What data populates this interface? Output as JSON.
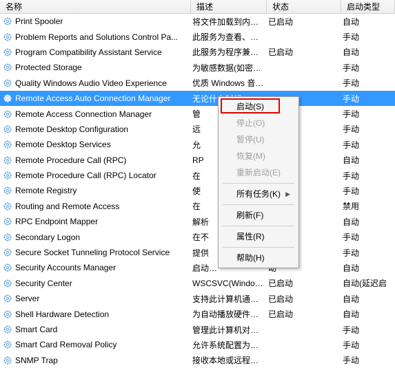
{
  "columns": {
    "name": "名称",
    "desc": "描述",
    "status": "状态",
    "startup": "启动类型"
  },
  "services": [
    {
      "name": "Print Spooler",
      "desc": "将文件加载到内存…",
      "status": "已启动",
      "startup": "自动"
    },
    {
      "name": "Problem Reports and Solutions Control Pa...",
      "desc": "此服务为查看、发…",
      "status": "",
      "startup": "手动"
    },
    {
      "name": "Program Compatibility Assistant Service",
      "desc": "此服务为程序兼容…",
      "status": "已启动",
      "startup": "自动"
    },
    {
      "name": "Protected Storage",
      "desc": "为敏感数据(如密…",
      "status": "",
      "startup": "手动"
    },
    {
      "name": "Quality Windows Audio Video Experience",
      "desc": "优质 Windows 音…",
      "status": "",
      "startup": "手动"
    },
    {
      "name": "Remote Access Auto Connection Manager",
      "desc": "无论什么时候，当…",
      "status": "",
      "startup": "手动"
    },
    {
      "name": "Remote Access Connection Manager",
      "desc": "管",
      "status": "",
      "startup": "手动"
    },
    {
      "name": "Remote Desktop Configuration",
      "desc": "远",
      "status": "",
      "startup": "手动"
    },
    {
      "name": "Remote Desktop Services",
      "desc": "允",
      "status": "",
      "startup": "手动"
    },
    {
      "name": "Remote Procedure Call (RPC)",
      "desc": "RP",
      "status": "动",
      "startup": "自动"
    },
    {
      "name": "Remote Procedure Call (RPC) Locator",
      "desc": "在",
      "status": "",
      "startup": "手动"
    },
    {
      "name": "Remote Registry",
      "desc": "使",
      "status": "",
      "startup": "手动"
    },
    {
      "name": "Routing and Remote Access",
      "desc": "在",
      "status": "",
      "startup": "禁用"
    },
    {
      "name": "RPC Endpoint Mapper",
      "desc": "解析",
      "status": "动",
      "startup": "自动"
    },
    {
      "name": "Secondary Logon",
      "desc": "在不",
      "status": "",
      "startup": "手动"
    },
    {
      "name": "Secure Socket Tunneling Protocol Service",
      "desc": "提供",
      "status": "",
      "startup": "手动"
    },
    {
      "name": "Security Accounts Manager",
      "desc": "启动…",
      "status": "动",
      "startup": "自动"
    },
    {
      "name": "Security Center",
      "desc": "WSCSVC(Windo…",
      "status": "已启动",
      "startup": "自动(延迟启"
    },
    {
      "name": "Server",
      "desc": "支持此计算机通过…",
      "status": "已启动",
      "startup": "自动"
    },
    {
      "name": "Shell Hardware Detection",
      "desc": "为自动播放硬件事…",
      "status": "已启动",
      "startup": "自动"
    },
    {
      "name": "Smart Card",
      "desc": "管理此计算机对智…",
      "status": "",
      "startup": "手动"
    },
    {
      "name": "Smart Card Removal Policy",
      "desc": "允许系统配置为移…",
      "status": "",
      "startup": "手动"
    },
    {
      "name": "SNMP Trap",
      "desc": "接收本地或远程简…",
      "status": "",
      "startup": "手动"
    }
  ],
  "selectedIndex": 5,
  "menu": {
    "start": "启动(S)",
    "stop": "停止(O)",
    "pause": "暂停(U)",
    "resume": "恢复(M)",
    "restart": "重新启动(E)",
    "allTasks": "所有任务(K)",
    "refresh": "刷新(F)",
    "properties": "属性(R)",
    "help": "帮助(H)"
  }
}
